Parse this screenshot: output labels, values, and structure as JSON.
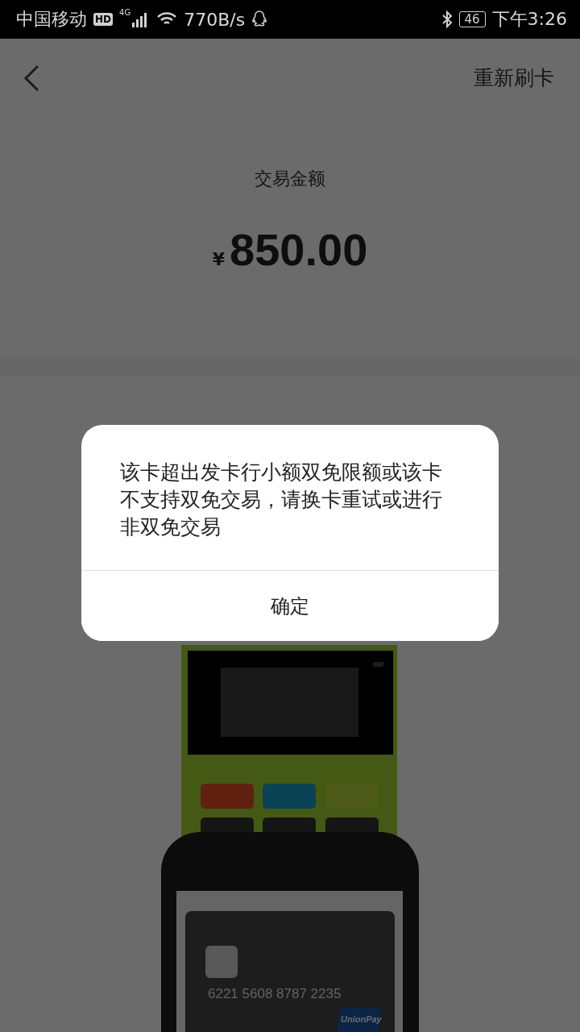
{
  "status_bar": {
    "carrier": "中国移动",
    "hd_badge": "HD",
    "network": "4G",
    "speed": "770B/s",
    "battery": "46",
    "time": "下午3:26"
  },
  "header": {
    "action": "重新刷卡"
  },
  "amount": {
    "label": "交易金额",
    "currency": "¥",
    "value": "850.00"
  },
  "illustration": {
    "card_number": "6221 5608 8787 2235",
    "card_logo": "UnionPay"
  },
  "dialog": {
    "message": "该卡超出发卡行小额双免限额或该卡不支持双免交易，请换卡重试或进行非双免交易",
    "button": "确定"
  }
}
